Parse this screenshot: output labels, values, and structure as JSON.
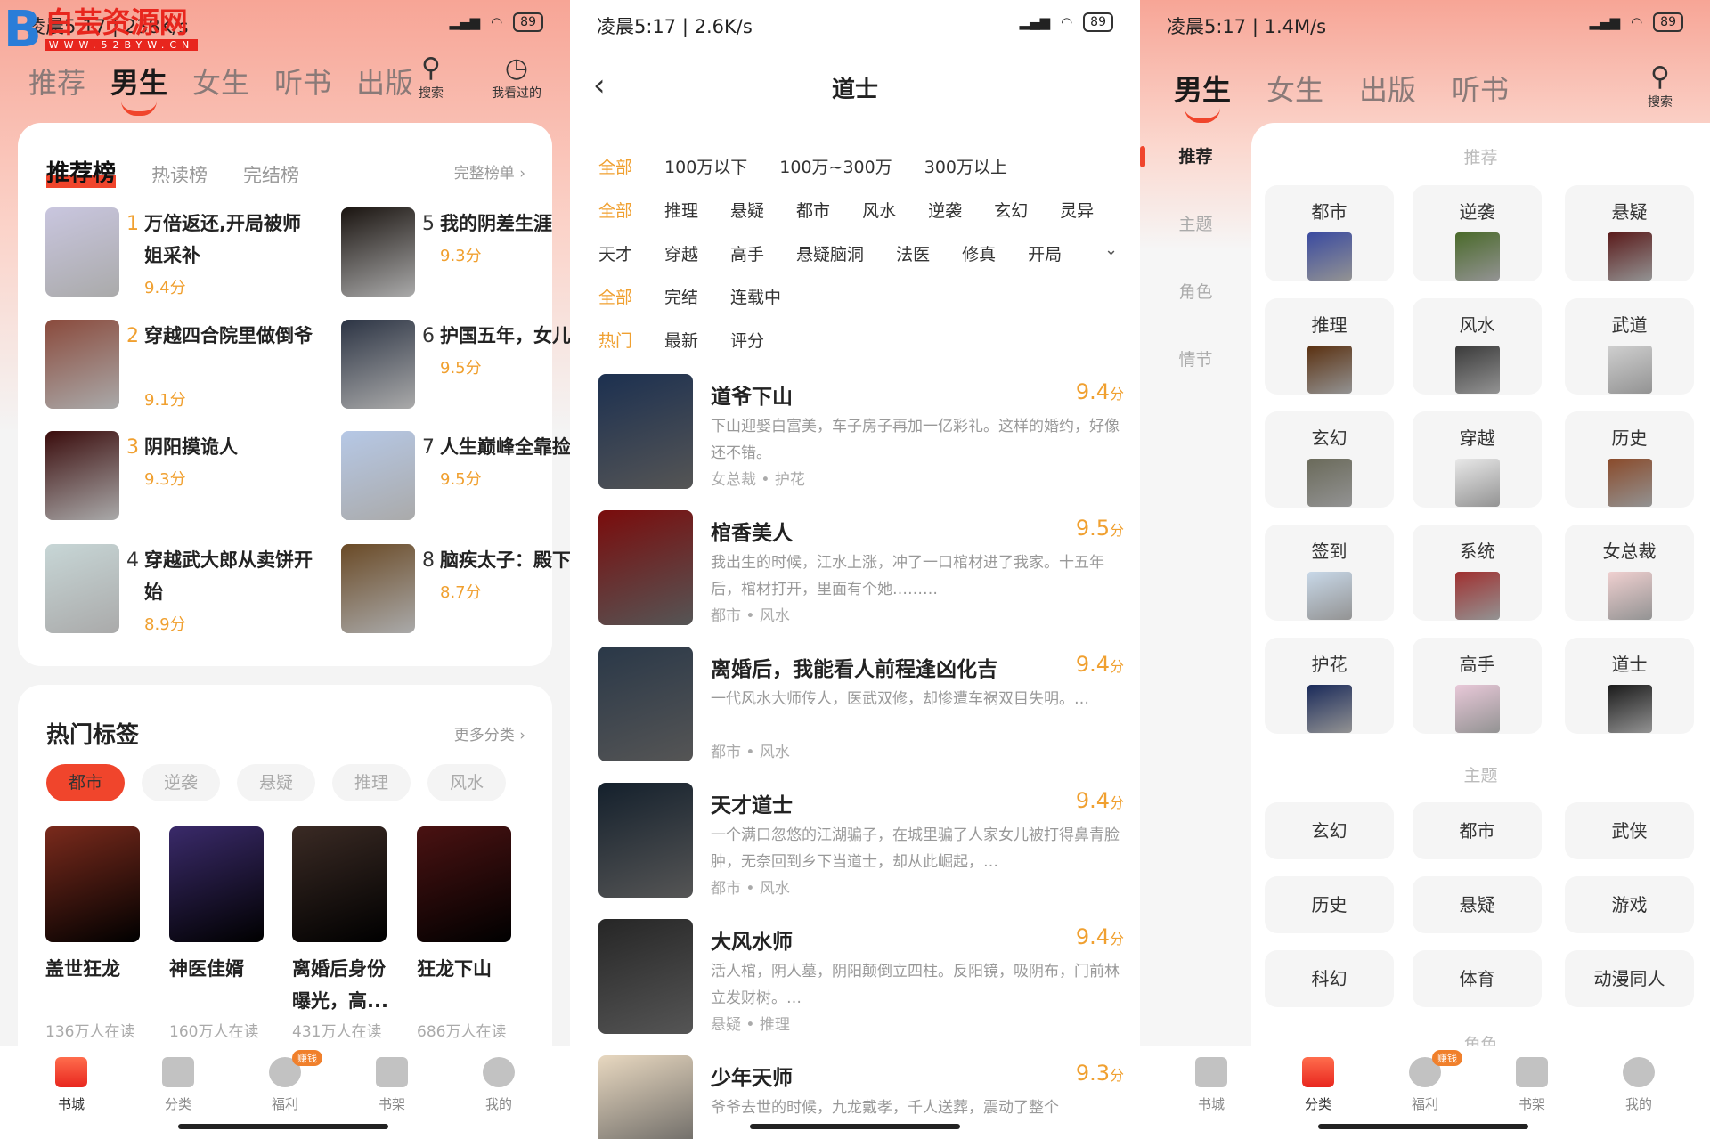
{
  "colors": {
    "accent": "#f0452c",
    "score": "#f0a030",
    "muted": "#999999"
  },
  "watermark": {
    "name": "白芸资源网",
    "url": "WWW.52BYW.CN"
  },
  "panel1": {
    "status": {
      "time": "凌晨5:17 | 238K/s",
      "battery": "89"
    },
    "tabs": [
      "推荐",
      "男生",
      "女生",
      "听书",
      "出版"
    ],
    "active_tab": 1,
    "search_label": "搜索",
    "history_label": "我看过的",
    "ranking": {
      "tabs": [
        "推荐榜",
        "热读榜",
        "完结榜"
      ],
      "more": "完整榜单",
      "items": [
        {
          "no": "1",
          "title": "万倍返还,开局被师姐采补",
          "score": "9.4分",
          "color": "#c9c6df"
        },
        {
          "no": "2",
          "title": "穿越四合院里做倒爷",
          "score": "9.1分",
          "color": "#8a4a3c"
        },
        {
          "no": "3",
          "title": "阴阳摸诡人",
          "score": "9.3分",
          "color": "#3a0c0c"
        },
        {
          "no": "4",
          "title": "穿越武大郎从卖饼开始",
          "score": "8.9分",
          "color": "#c7d6d6"
        },
        {
          "no": "5",
          "title": "我的阴差生涯",
          "score": "9.3分",
          "color": "#1a1410"
        },
        {
          "no": "6",
          "title": "护国五年，女儿发来求救短信",
          "score": "9.5分",
          "color": "#2c3444"
        },
        {
          "no": "7",
          "title": "人生巅峰全靠捡",
          "score": "9.5分",
          "color": "#b6c8e6"
        },
        {
          "no": "8",
          "title": "脑疾太子：殿下求你做个人吧",
          "score": "8.7分",
          "color": "#6a4a26"
        }
      ]
    },
    "hot_tags": {
      "title": "热门标签",
      "more": "更多分类",
      "tags": [
        "都市",
        "逆袭",
        "悬疑",
        "推理",
        "风水"
      ],
      "active": 0,
      "books": [
        {
          "title": "盖世狂龙",
          "readers": "136万人在读",
          "color": "#7a2a1c"
        },
        {
          "title": "神医佳婿",
          "readers": "160万人在读",
          "color": "#3a2a6a"
        },
        {
          "title": "离婚后身份曝光，高...",
          "readers": "431万人在读",
          "color": "#3a2a24"
        },
        {
          "title": "狂龙下山",
          "readers": "686万人在读",
          "color": "#4a1212"
        }
      ]
    }
  },
  "nav": {
    "items": [
      "书城",
      "分类",
      "福利",
      "书架",
      "我的"
    ],
    "badge": "赚钱"
  },
  "panel2": {
    "status": {
      "time": "凌晨5:17 | 2.6K/s",
      "battery": "89"
    },
    "title": "道士",
    "filters": [
      {
        "items": [
          "全部",
          "100万以下",
          "100万~300万",
          "300万以上"
        ],
        "active": 0
      },
      {
        "items": [
          "全部",
          "推理",
          "悬疑",
          "都市",
          "风水",
          "逆袭",
          "玄幻",
          "灵异"
        ],
        "active": 0
      },
      {
        "items": [
          "天才",
          "穿越",
          "高手",
          "悬疑脑洞",
          "法医",
          "修真",
          "开局"
        ],
        "active": -1
      },
      {
        "items": [
          "全部",
          "完结",
          "连载中"
        ],
        "active": 0
      },
      {
        "items": [
          "热门",
          "最新",
          "评分"
        ],
        "active": 0
      }
    ],
    "books": [
      {
        "title": "道爷下山",
        "score": "9.4",
        "unit": "分",
        "desc": "下山迎娶白富美，车子房子再加一亿彩礼。这样的婚约，好像还不错。",
        "tags": "女总裁 • 护花",
        "color": "#1c3050"
      },
      {
        "title": "棺香美人",
        "score": "9.5",
        "unit": "分",
        "desc": "我出生的时候，江水上涨，冲了一口棺材进了我家。十五年后，棺材打开，里面有个她………",
        "tags": "都市 • 风水",
        "color": "#7a0c0c"
      },
      {
        "title": "离婚后，我能看人前程逢凶化吉",
        "score": "9.4",
        "unit": "分",
        "desc": "一代风水大师传人，医武双修，却惨遭车祸双目失明。…",
        "tags": "都市 • 风水",
        "color": "#2a3848"
      },
      {
        "title": "天才道士",
        "score": "9.4",
        "unit": "分",
        "desc": "一个满口忽悠的江湖骗子，在城里骗了人家女儿被打得鼻青脸肿，无奈回到乡下当道士，却从此崛起，…",
        "tags": "都市 • 风水",
        "color": "#14202c"
      },
      {
        "title": "大风水师",
        "score": "9.4",
        "unit": "分",
        "desc": "活人棺，阴人墓，阴阳颠倒立四柱。反阳镜，吸阴布，门前林立发财树。…",
        "tags": "悬疑 • 推理",
        "color": "#262626"
      },
      {
        "title": "少年天师",
        "score": "9.3",
        "unit": "分",
        "desc": "爷爷去世的时候，九龙戴孝，千人送葬，震动了整个",
        "tags": "",
        "color": "#e8d8c0"
      }
    ]
  },
  "panel3": {
    "status": {
      "time": "凌晨5:17 | 1.4M/s",
      "battery": "89"
    },
    "tabs": [
      "男生",
      "女生",
      "出版",
      "听书"
    ],
    "active_tab": 0,
    "search_label": "搜索",
    "sidebar": [
      "推荐",
      "主题",
      "角色",
      "情节"
    ],
    "sidebar_active": 0,
    "rec_title": "推荐",
    "rec": [
      {
        "name": "都市",
        "color": "#3a4aa0"
      },
      {
        "name": "逆袭",
        "color": "#4a6a2a"
      },
      {
        "name": "悬疑",
        "color": "#5a1a1a"
      },
      {
        "name": "推理",
        "color": "#5a3010"
      },
      {
        "name": "风水",
        "color": "#3a3a3a"
      },
      {
        "name": "武道",
        "color": "#cfcfcf"
      },
      {
        "name": "玄幻",
        "color": "#6a6a5a"
      },
      {
        "name": "穿越",
        "color": "#e8e8e8"
      },
      {
        "name": "历史",
        "color": "#8a4a2a"
      },
      {
        "name": "签到",
        "color": "#c8d8e8"
      },
      {
        "name": "系统",
        "color": "#a03030"
      },
      {
        "name": "女总裁",
        "color": "#f0d0d0"
      },
      {
        "name": "护花",
        "color": "#1a2a5a"
      },
      {
        "name": "高手",
        "color": "#e8c8d8"
      },
      {
        "name": "道士",
        "color": "#1a1a1a"
      }
    ],
    "theme_title": "主题",
    "themes": [
      "玄幻",
      "都市",
      "武侠",
      "历史",
      "悬疑",
      "游戏",
      "科幻",
      "体育",
      "动漫同人"
    ],
    "next_title": "角色"
  }
}
